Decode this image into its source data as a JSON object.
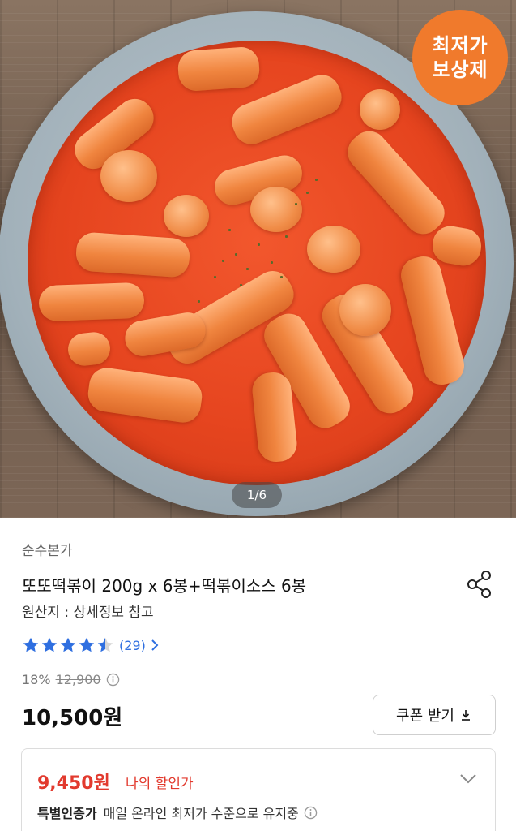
{
  "hero": {
    "badge_line1": "최저가",
    "badge_line2": "보상제",
    "pager": "1/6"
  },
  "product": {
    "brand": "순수본가",
    "title": "또또떡볶이 200g x 6봉+떡볶이소스 6봉",
    "origin": "원산지 : 상세정보 참고",
    "rating": 4.5,
    "review_count": "(29)",
    "discount_rate": "18%",
    "original_price": "12,900",
    "price": "10,500원",
    "coupon_label": "쿠폰 받기"
  },
  "deal": {
    "price": "9,450원",
    "label": "나의 할인가",
    "note_bold": "특별인증가",
    "note_text": "매일 온라인 최저가 수준으로 유지중"
  },
  "colors": {
    "accent_red": "#e23a2e",
    "link_blue": "#2f6fe0",
    "badge_orange": "#f07a2c"
  }
}
